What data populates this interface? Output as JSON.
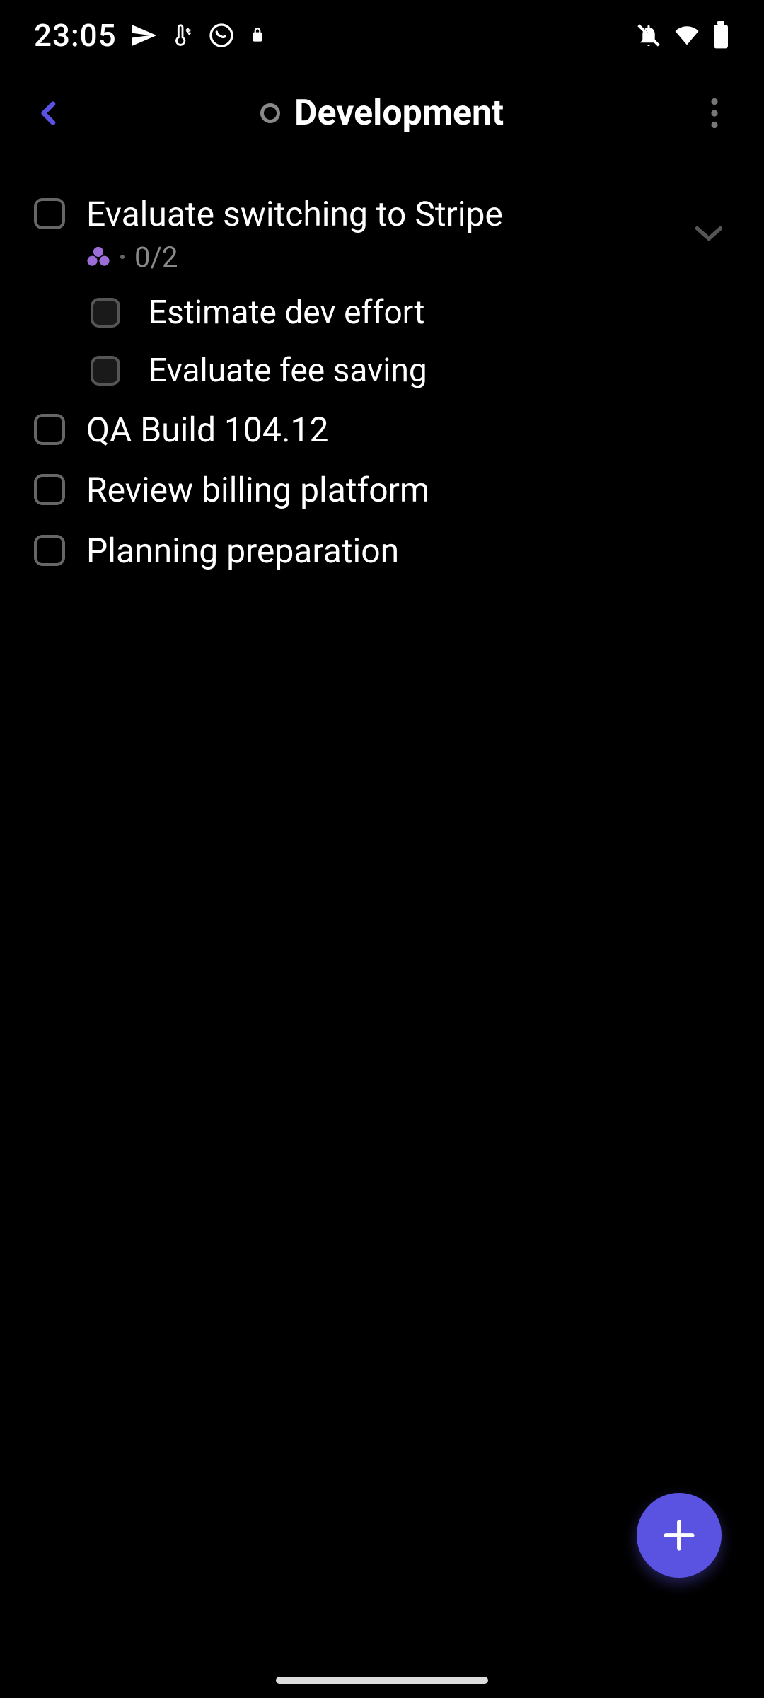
{
  "status": {
    "time": "23:05"
  },
  "header": {
    "title": "Development"
  },
  "tasks": [
    {
      "title": "Evaluate switching to Stripe",
      "count": "0/2",
      "subtasks": [
        {
          "title": "Estimate dev effort"
        },
        {
          "title": "Evaluate fee saving"
        }
      ]
    },
    {
      "title": "QA Build 104.12"
    },
    {
      "title": "Review billing platform"
    },
    {
      "title": "Planning preparation"
    }
  ],
  "colors": {
    "accent": "#5a52e0",
    "tag": "#9b6dd7"
  }
}
